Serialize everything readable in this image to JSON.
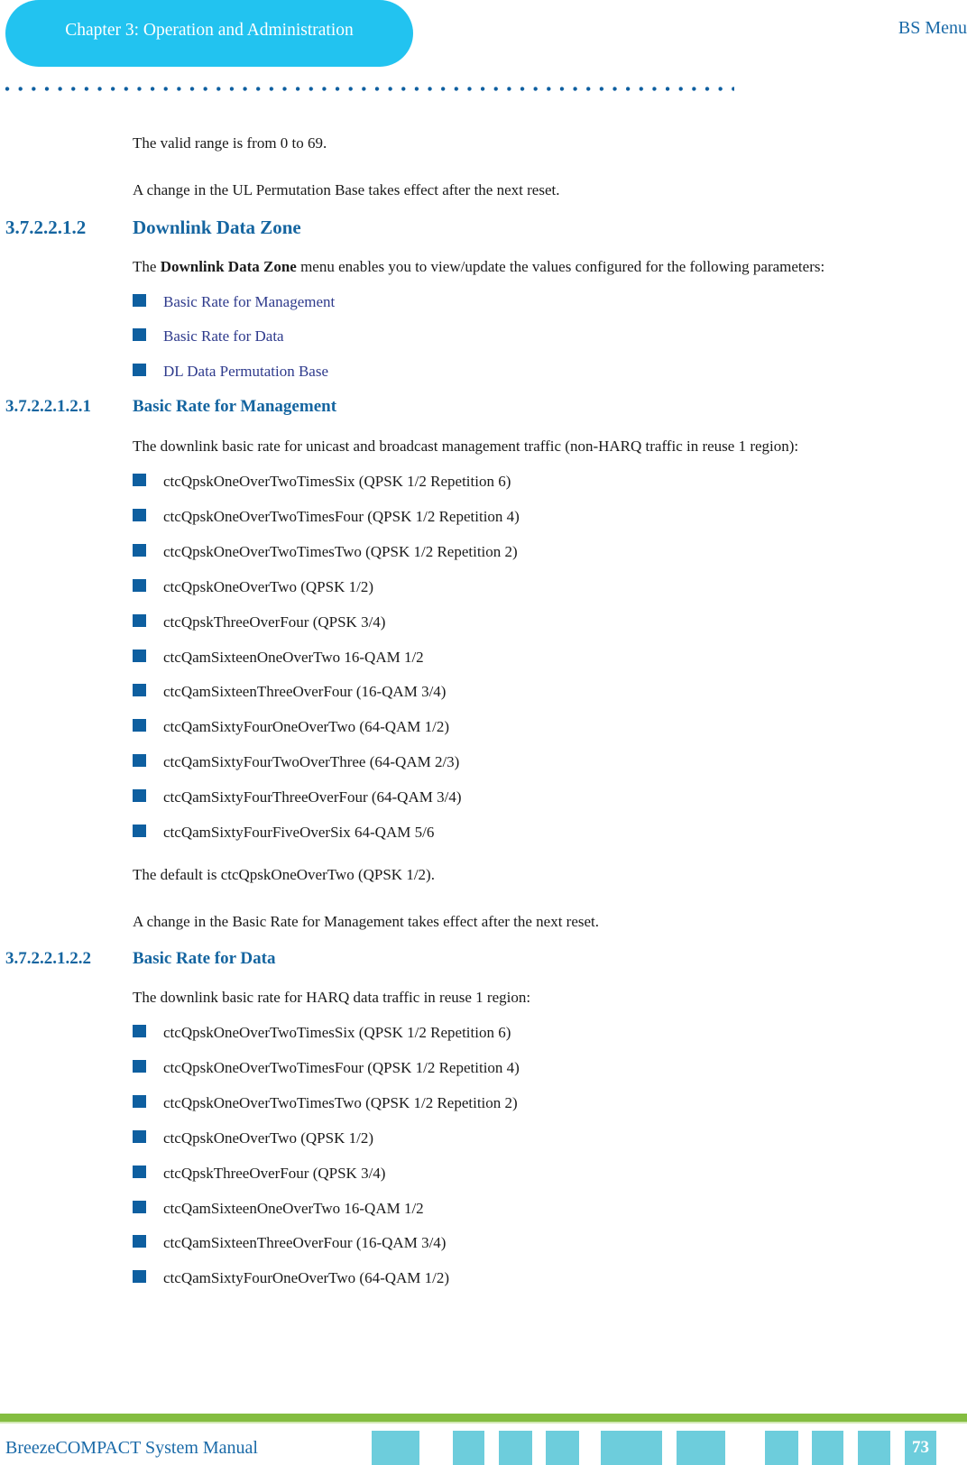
{
  "header": {
    "chapter": "Chapter 3: Operation and Administration",
    "section": "BS Menu"
  },
  "intro": {
    "range_text": "The valid range is from 0 to 69.",
    "reset_note": "A change in the UL Permutation Base takes effect after the next reset."
  },
  "section_dl_data_zone": {
    "number": "3.7.2.2.1.2",
    "title": "Downlink Data Zone",
    "desc_prefix": "The ",
    "desc_bold": "Downlink Data Zone",
    "desc_suffix": " menu enables you to view/update the values configured for the following parameters:",
    "links": [
      "Basic Rate for Management",
      "Basic Rate for Data",
      "DL Data Permutation Base"
    ]
  },
  "section_basic_rate_mgmt": {
    "number": "3.7.2.2.1.2.1",
    "title": "Basic Rate for Management",
    "desc": "The downlink basic rate for unicast and broadcast management traffic (non-HARQ traffic in reuse 1 region):",
    "options": [
      "ctcQpskOneOverTwoTimesSix (QPSK 1/2 Repetition 6)",
      "ctcQpskOneOverTwoTimesFour (QPSK 1/2 Repetition 4)",
      "ctcQpskOneOverTwoTimesTwo (QPSK 1/2 Repetition 2)",
      "ctcQpskOneOverTwo (QPSK 1/2)",
      "ctcQpskThreeOverFour (QPSK 3/4)",
      "ctcQamSixteenOneOverTwo 16-QAM 1/2",
      "ctcQamSixteenThreeOverFour (16-QAM 3/4)",
      "ctcQamSixtyFourOneOverTwo (64-QAM 1/2)",
      "ctcQamSixtyFourTwoOverThree (64-QAM 2/3)",
      "ctcQamSixtyFourThreeOverFour (64-QAM 3/4)",
      "ctcQamSixtyFourFiveOverSix 64-QAM 5/6"
    ],
    "default_text": "The default is ctcQpskOneOverTwo (QPSK 1/2).",
    "reset_note": "A change in the Basic Rate for Management takes effect after the next reset."
  },
  "section_basic_rate_data": {
    "number": "3.7.2.2.1.2.2",
    "title": "Basic Rate for Data",
    "desc": "The downlink basic rate for HARQ data traffic in reuse 1 region:",
    "options": [
      "ctcQpskOneOverTwoTimesSix (QPSK 1/2 Repetition 6)",
      "ctcQpskOneOverTwoTimesFour (QPSK 1/2 Repetition 4)",
      "ctcQpskOneOverTwoTimesTwo (QPSK 1/2 Repetition 2)",
      "ctcQpskOneOverTwo (QPSK 1/2)",
      "ctcQpskThreeOverFour (QPSK 3/4)",
      "ctcQamSixteenOneOverTwo 16-QAM 1/2",
      "ctcQamSixteenThreeOverFour (16-QAM 3/4)",
      "ctcQamSixtyFourOneOverTwo (64-QAM 1/2)"
    ]
  },
  "footer": {
    "manual_title": "BreezeCOMPACT System Manual",
    "page_number": "73"
  },
  "colors": {
    "chapter_pill": "#22c3f0",
    "heading_blue": "#1565a0",
    "bullet": "#0e5fa0",
    "link": "#2e3a8c",
    "footer_green": "#84bd41",
    "footer_blocks": "#6dcddc"
  }
}
